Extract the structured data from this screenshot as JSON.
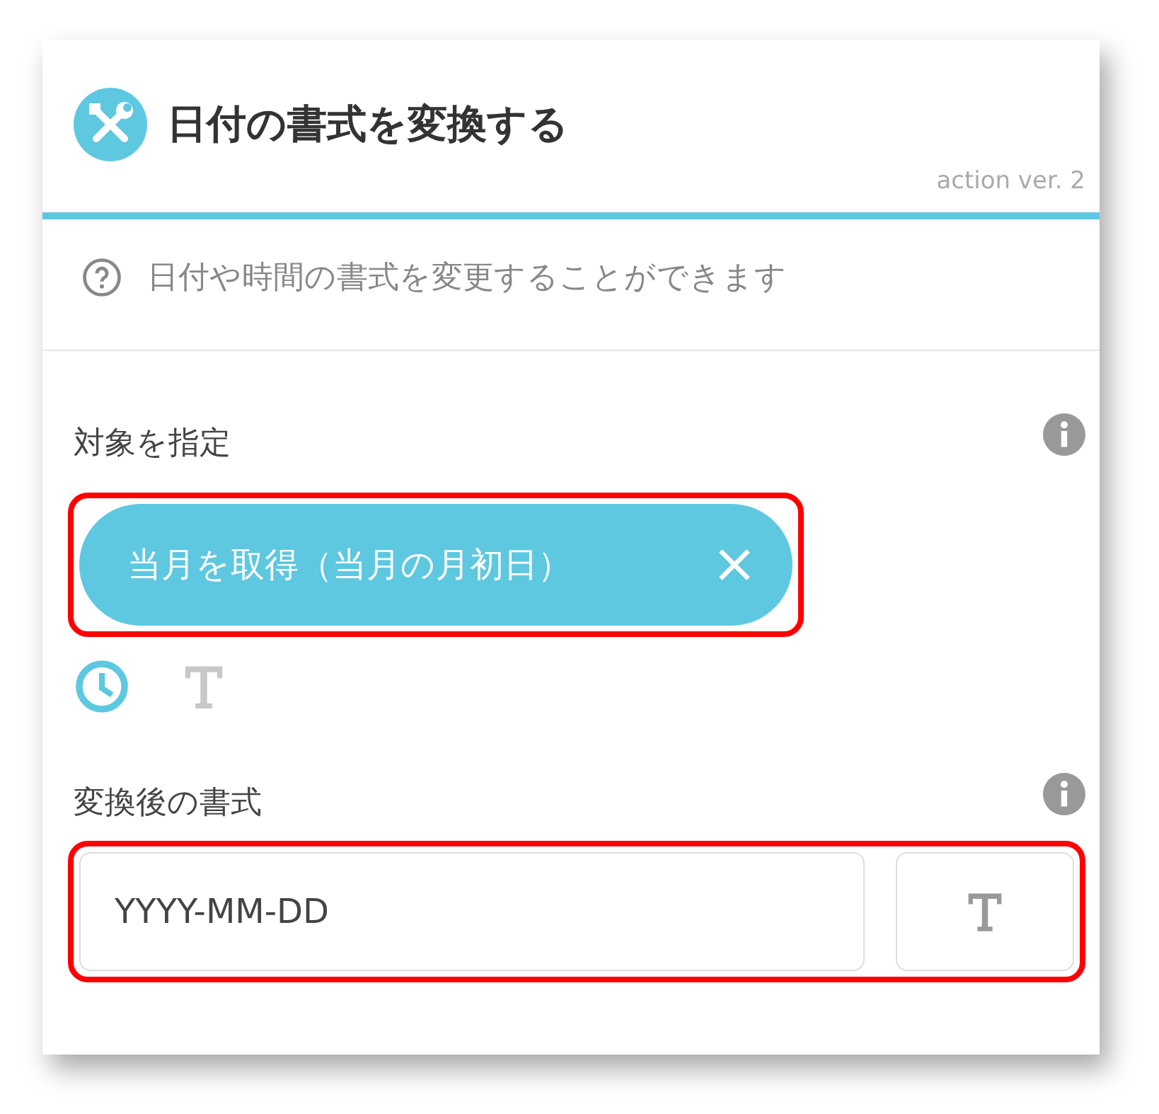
{
  "header": {
    "title": "日付の書式を変換する",
    "version": "action ver. 2"
  },
  "description": "日付や時間の書式を変更することができます",
  "target": {
    "label": "対象を指定",
    "highlighted": true,
    "chip": {
      "text": "当月を取得（当月の月初日）"
    },
    "modes": [
      {
        "kind": "date",
        "selected": true
      },
      {
        "kind": "text",
        "selected": false
      }
    ]
  },
  "format": {
    "label": "変換後の書式",
    "highlighted": true,
    "value": "YYYY-MM-DD",
    "mode": {
      "kind": "text",
      "selected": false
    }
  }
}
